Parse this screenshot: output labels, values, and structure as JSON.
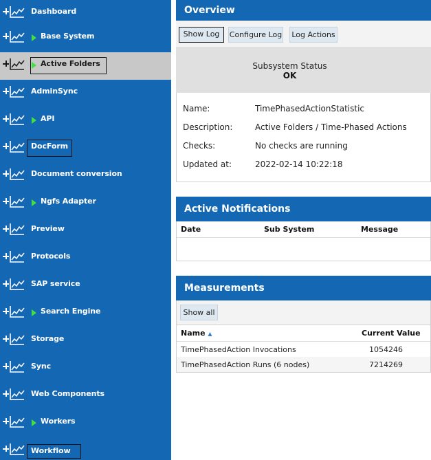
{
  "sidebar": {
    "items": [
      {
        "label": "Dashboard"
      },
      {
        "label": "Base System"
      },
      {
        "label": "Active Folders"
      },
      {
        "label": "AdminSync"
      },
      {
        "label": "API"
      },
      {
        "label": "DocForm"
      },
      {
        "label": "Document conversion"
      },
      {
        "label": "Ngfs Adapter"
      },
      {
        "label": "Preview"
      },
      {
        "label": "Protocols"
      },
      {
        "label": "SAP service"
      },
      {
        "label": "Search Engine"
      },
      {
        "label": "Storage"
      },
      {
        "label": "Sync"
      },
      {
        "label": "Web Components"
      },
      {
        "label": "Workers"
      },
      {
        "label": "Workflow"
      }
    ]
  },
  "overview": {
    "title": "Overview",
    "buttons": {
      "show_log": "Show Log",
      "configure_log": "Configure Log",
      "log_actions": "Log Actions"
    },
    "status_label": "Subsystem Status",
    "status_value": "OK",
    "details": [
      {
        "key": "Name:",
        "value": "TimePhasedActionStatistic"
      },
      {
        "key": "Description:",
        "value": "Active Folders / Time-Phased Actions"
      },
      {
        "key": "Checks:",
        "value": "No checks are running"
      },
      {
        "key": "Updated at:",
        "value": "2022-02-14 10:22:18"
      }
    ]
  },
  "notifications": {
    "title": "Active Notifications",
    "columns": {
      "date": "Date",
      "subsystem": "Sub System",
      "message": "Message"
    }
  },
  "measurements": {
    "title": "Measurements",
    "show_all": "Show all",
    "columns": {
      "name": "Name",
      "sort_glyph": "▲",
      "current_value": "Current Value"
    },
    "rows": [
      {
        "name": "TimePhasedAction Invocations",
        "value": "1054246"
      },
      {
        "name": "TimePhasedAction Runs (6 nodes)",
        "value": "7214269"
      }
    ]
  },
  "colors": {
    "sidebar_bg": "#1467b3",
    "selected_bg": "#c8c8c8",
    "arrow": "#44dd44",
    "header_bg": "#1467b3",
    "button_bg": "#dde8f0",
    "status_bg": "#e0e0e0"
  },
  "icons": {
    "expand": "plus-icon",
    "stats": "line-chart-icon",
    "expander": "triangle-right-icon",
    "sort": "sort-ascending-icon"
  }
}
